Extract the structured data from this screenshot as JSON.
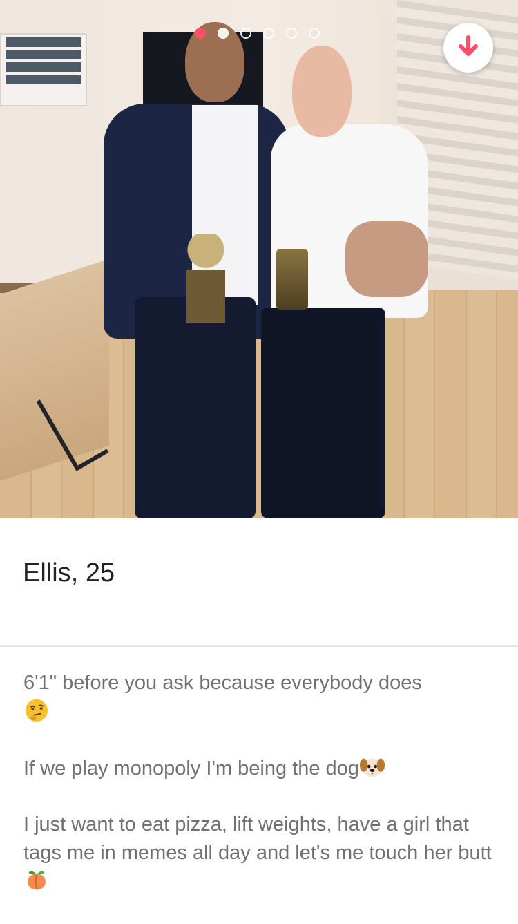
{
  "photo": {
    "pager_dots": [
      {
        "state": "active"
      },
      {
        "state": "filled"
      },
      {
        "state": "outline"
      },
      {
        "state": "outline"
      },
      {
        "state": "outline"
      },
      {
        "state": "outline"
      }
    ],
    "expand_button_icon": "arrow-down-icon",
    "accent_color": "#fd5068"
  },
  "profile": {
    "name": "Ellis",
    "separator": ",",
    "age": "25"
  },
  "bio": {
    "line1": "6'1\" before you ask because everybody does",
    "line1_emoji": "thinking-face-icon",
    "line2": "If we play monopoly I'm being the dog",
    "line2_emoji": "dog-face-icon",
    "line3": "I just want to eat pizza, lift weights, have a girl that tags me in memes all day and let's me touch her butt",
    "line3_emoji": "peach-icon"
  }
}
